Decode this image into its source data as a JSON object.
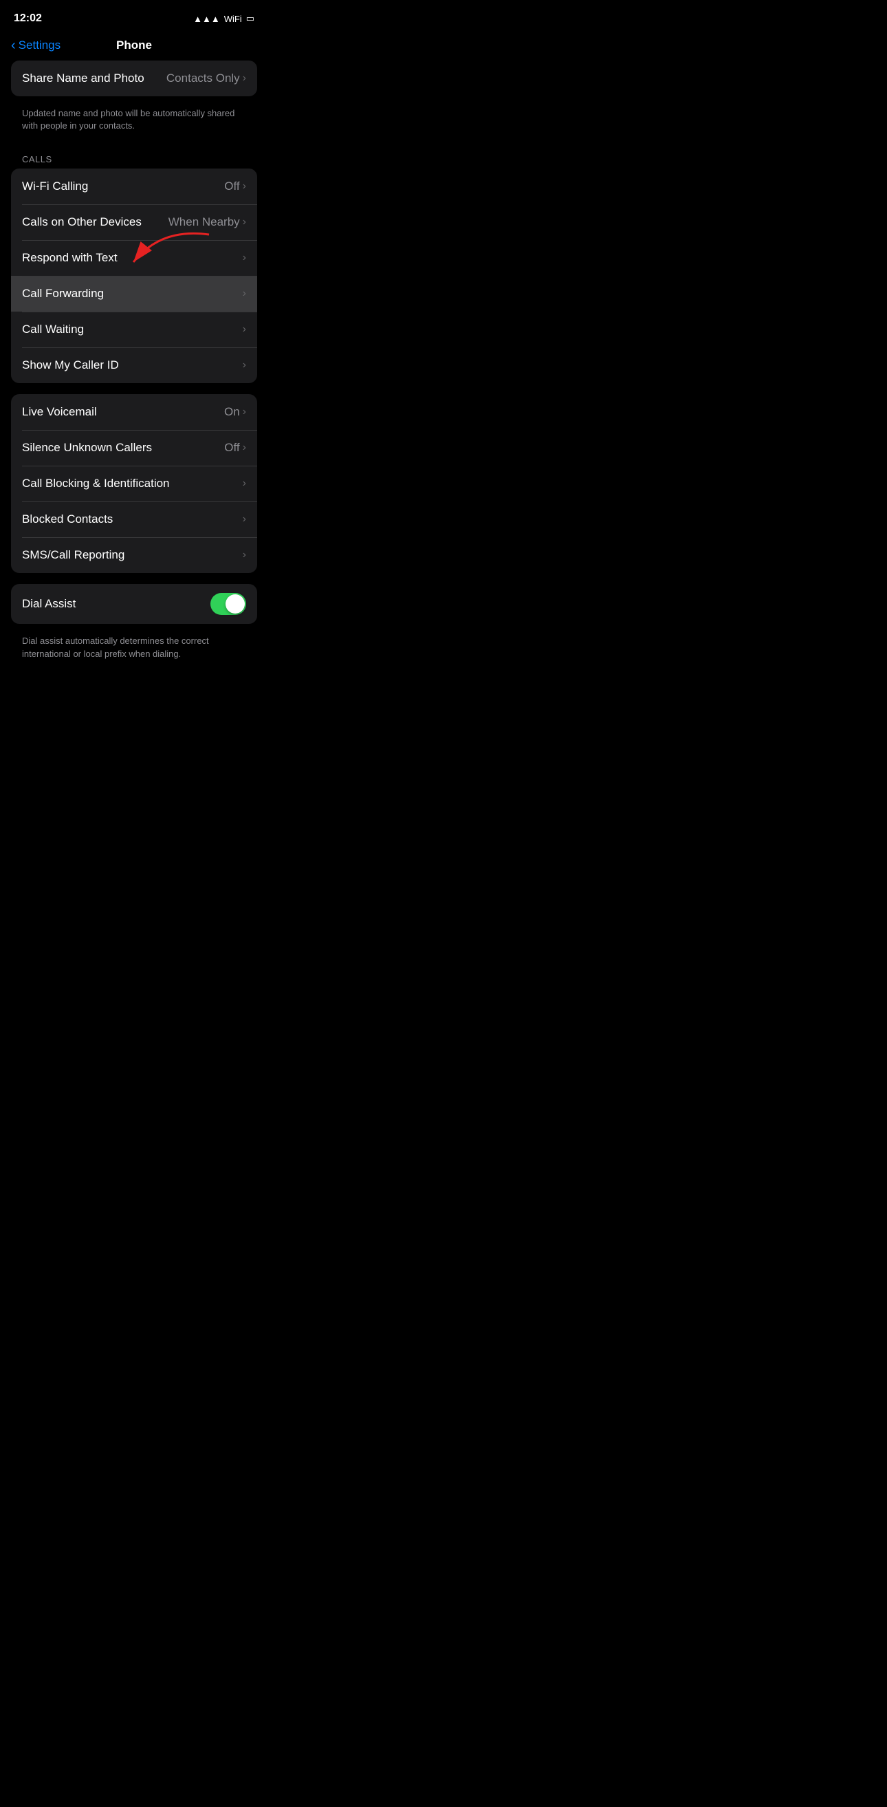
{
  "statusBar": {
    "time": "12:02",
    "icons": "▲ ▲ ▼"
  },
  "nav": {
    "backLabel": "Settings",
    "title": "Phone"
  },
  "shareNamePhoto": {
    "label": "Share Name and Photo",
    "value": "Contacts Only"
  },
  "shareDescription": "Updated name and photo will be automatically shared with people in your contacts.",
  "callsSectionLabel": "CALLS",
  "callsItems": [
    {
      "label": "Wi-Fi Calling",
      "value": "Off",
      "highlighted": false
    },
    {
      "label": "Calls on Other Devices",
      "value": "When Nearby",
      "highlighted": false
    },
    {
      "label": "Respond with Text",
      "value": "",
      "highlighted": false
    },
    {
      "label": "Call Forwarding",
      "value": "",
      "highlighted": true
    },
    {
      "label": "Call Waiting",
      "value": "",
      "highlighted": false
    },
    {
      "label": "Show My Caller ID",
      "value": "",
      "highlighted": false
    }
  ],
  "voicemailItems": [
    {
      "label": "Live Voicemail",
      "value": "On",
      "highlighted": false
    },
    {
      "label": "Silence Unknown Callers",
      "value": "Off",
      "highlighted": false
    },
    {
      "label": "Call Blocking & Identification",
      "value": "",
      "highlighted": false
    },
    {
      "label": "Blocked Contacts",
      "value": "",
      "highlighted": false
    },
    {
      "label": "SMS/Call Reporting",
      "value": "",
      "highlighted": false
    }
  ],
  "dialAssist": {
    "label": "Dial Assist",
    "toggleOn": true,
    "description": "Dial assist automatically determines the correct international or local prefix when dialing."
  },
  "icons": {
    "chevron": "›",
    "backChevron": "‹"
  }
}
